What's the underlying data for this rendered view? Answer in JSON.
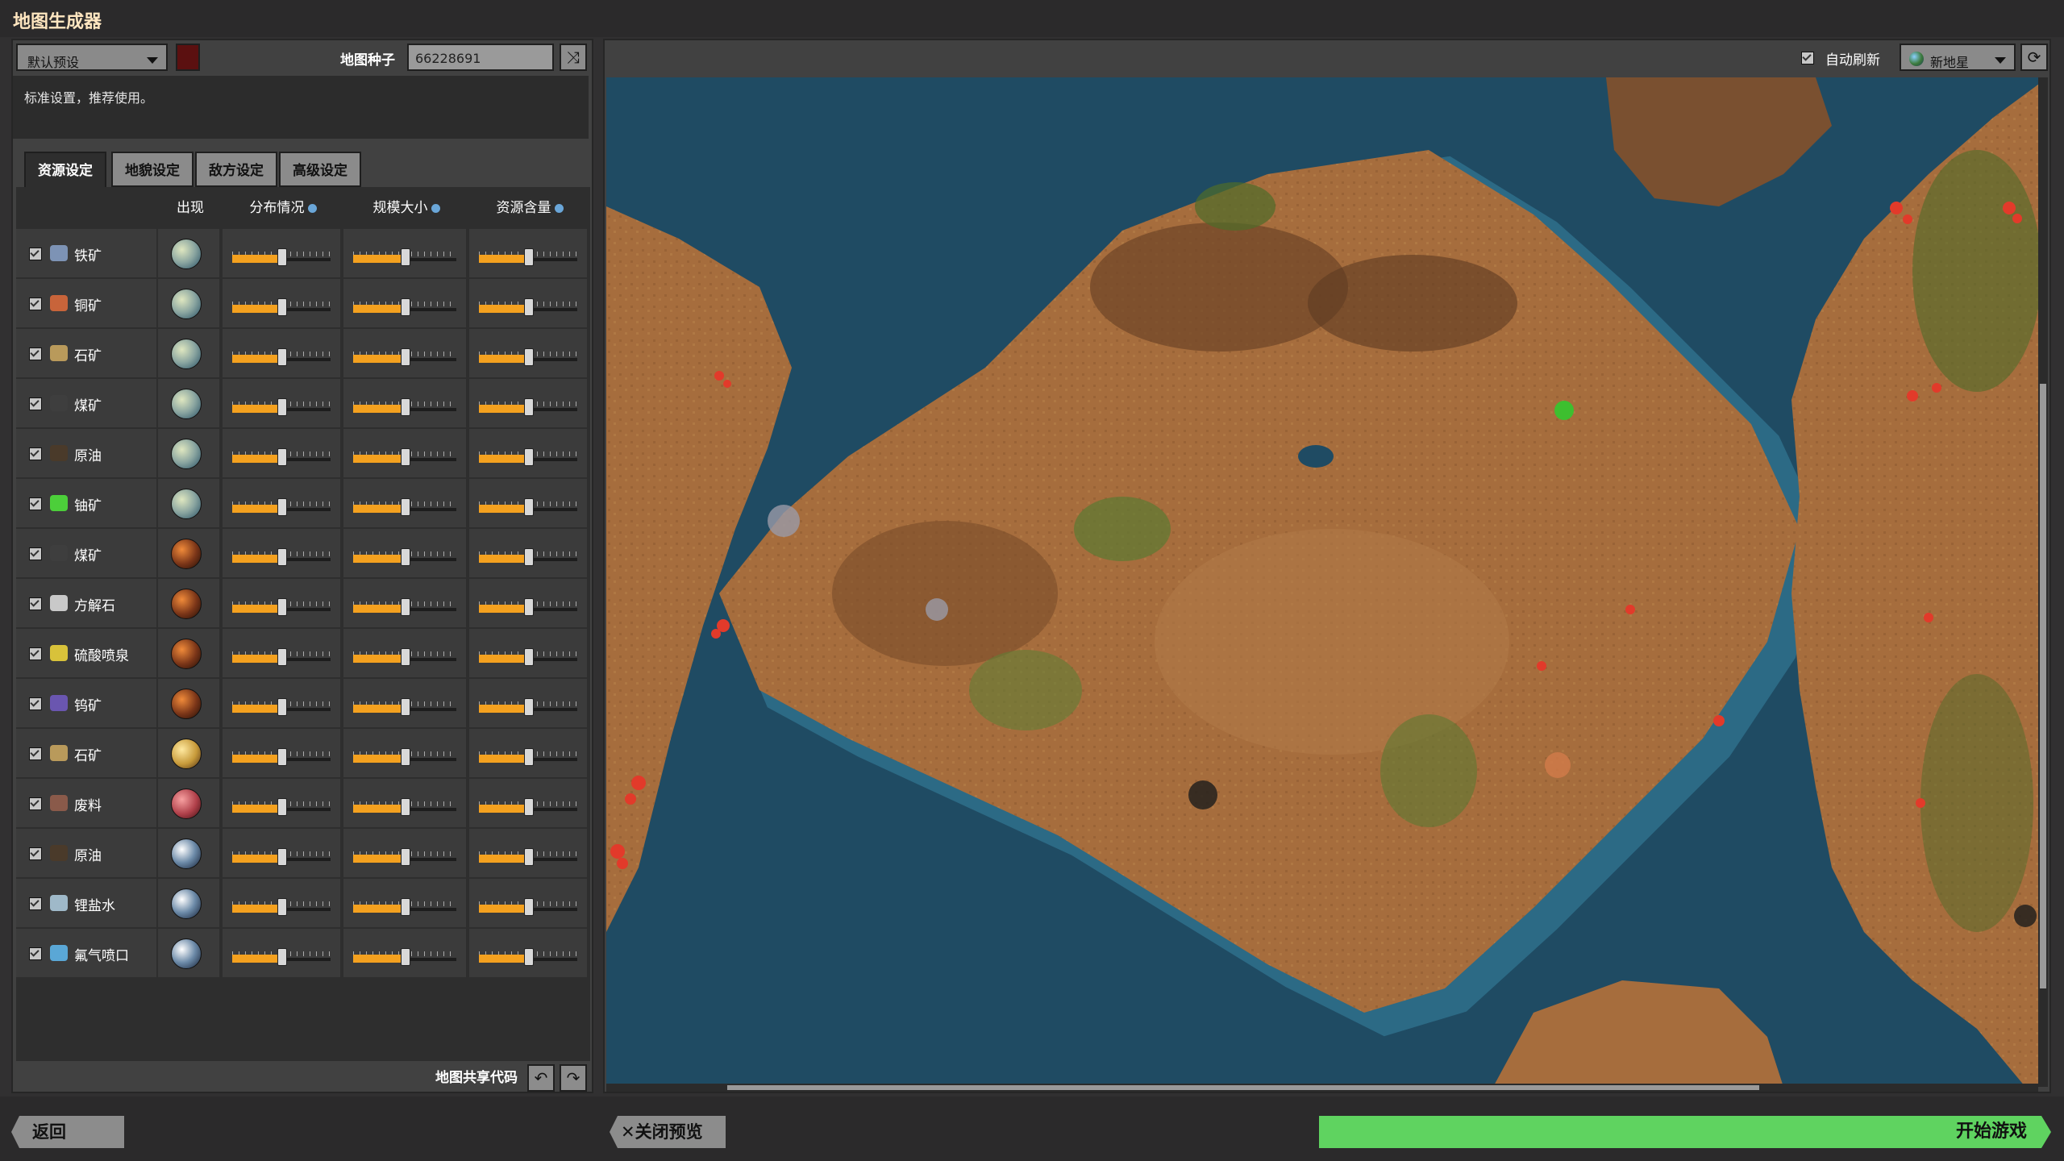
{
  "window": {
    "title": "地图生成器"
  },
  "preset": {
    "selected": "默认预设",
    "description": "标准设置，推荐使用。"
  },
  "seed": {
    "label": "地图种子",
    "value": "66228691"
  },
  "tabs": [
    {
      "label": "资源设定",
      "active": true
    },
    {
      "label": "地貌设定",
      "active": false
    },
    {
      "label": "敌方设定",
      "active": false
    },
    {
      "label": "高级设定",
      "active": false
    }
  ],
  "table": {
    "headers": {
      "appear": "出现",
      "frequency": "分布情况",
      "size": "规模大小",
      "richness": "资源含量"
    },
    "rows": [
      {
        "name": "铁矿",
        "checked": true,
        "icon": "iron-ore-icon",
        "icon_color": "#7d93b5",
        "planet": "nauvis",
        "frequency": 0.5,
        "size": 0.5,
        "richness": 0.5
      },
      {
        "name": "铜矿",
        "checked": true,
        "icon": "copper-ore-icon",
        "icon_color": "#c8643a",
        "planet": "nauvis",
        "frequency": 0.5,
        "size": 0.5,
        "richness": 0.5
      },
      {
        "name": "石矿",
        "checked": true,
        "icon": "stone-icon",
        "icon_color": "#b99a5b",
        "planet": "nauvis",
        "frequency": 0.5,
        "size": 0.5,
        "richness": 0.5
      },
      {
        "name": "煤矿",
        "checked": true,
        "icon": "coal-icon",
        "icon_color": "#3e3e3e",
        "planet": "nauvis",
        "frequency": 0.5,
        "size": 0.5,
        "richness": 0.5
      },
      {
        "name": "原油",
        "checked": true,
        "icon": "crude-oil-icon",
        "icon_color": "#4a3a2a",
        "planet": "nauvis",
        "frequency": 0.5,
        "size": 0.5,
        "richness": 0.5
      },
      {
        "name": "铀矿",
        "checked": true,
        "icon": "uranium-ore-icon",
        "icon_color": "#4ccf3a",
        "planet": "nauvis",
        "frequency": 0.5,
        "size": 0.5,
        "richness": 0.5
      },
      {
        "name": "煤矿",
        "checked": true,
        "icon": "coal-icon",
        "icon_color": "#3e3e3e",
        "planet": "vulcanus",
        "frequency": 0.5,
        "size": 0.5,
        "richness": 0.5
      },
      {
        "name": "方解石",
        "checked": true,
        "icon": "calcite-icon",
        "icon_color": "#c9c9c9",
        "planet": "vulcanus",
        "frequency": 0.5,
        "size": 0.5,
        "richness": 0.5
      },
      {
        "name": "硫酸喷泉",
        "checked": true,
        "icon": "sulfuric-acid-geyser-icon",
        "icon_color": "#d8c23a",
        "planet": "vulcanus",
        "frequency": 0.5,
        "size": 0.5,
        "richness": 0.5
      },
      {
        "name": "钨矿",
        "checked": true,
        "icon": "tungsten-ore-icon",
        "icon_color": "#6a56b0",
        "planet": "vulcanus",
        "frequency": 0.5,
        "size": 0.5,
        "richness": 0.5
      },
      {
        "name": "石矿",
        "checked": true,
        "icon": "stone-icon",
        "icon_color": "#b99a5b",
        "planet": "fulgora-gold",
        "frequency": 0.5,
        "size": 0.5,
        "richness": 0.5
      },
      {
        "name": "废料",
        "checked": true,
        "icon": "scrap-icon",
        "icon_color": "#8a5a4a",
        "planet": "fulgora",
        "frequency": 0.5,
        "size": 0.5,
        "richness": 0.5
      },
      {
        "name": "原油",
        "checked": true,
        "icon": "crude-oil-icon",
        "icon_color": "#4a3a2a",
        "planet": "aquilo",
        "frequency": 0.5,
        "size": 0.5,
        "richness": 0.5
      },
      {
        "name": "锂盐水",
        "checked": true,
        "icon": "lithium-brine-icon",
        "icon_color": "#9fb9c9",
        "planet": "aquilo",
        "frequency": 0.5,
        "size": 0.5,
        "richness": 0.5
      },
      {
        "name": "氟气喷口",
        "checked": true,
        "icon": "fluorine-vent-icon",
        "icon_color": "#5aa7d6",
        "planet": "aquilo",
        "frequency": 0.5,
        "size": 0.5,
        "richness": 0.5
      }
    ]
  },
  "share": {
    "label": "地图共享代码"
  },
  "preview": {
    "auto_refresh_label": "自动刷新",
    "auto_refresh": true,
    "planet_selected": "新地星"
  },
  "buttons": {
    "back": "返回",
    "close_preview": "关闭预览",
    "start": "开始游戏"
  },
  "icons": {
    "shuffle": "shuffle-icon",
    "refresh": "refresh-icon",
    "import": "import-icon",
    "export": "export-icon",
    "close": "close-icon"
  },
  "colors": {
    "accent_orange": "#f4a11f",
    "start_green": "#5fd360",
    "water": "#1f4b63",
    "land": "#a06a3a"
  }
}
